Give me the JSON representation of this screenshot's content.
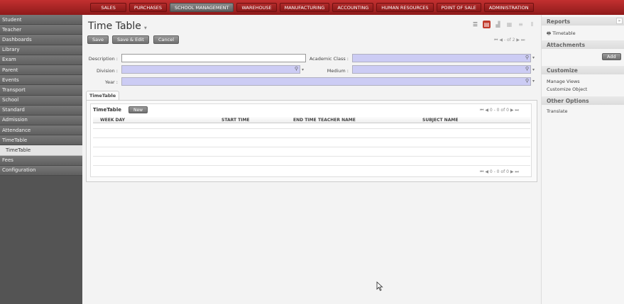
{
  "top_menu": [
    "SALES",
    "PURCHASES",
    "SCHOOL MANAGEMENT",
    "WAREHOUSE",
    "MANUFACTURING",
    "ACCOUNTING",
    "HUMAN RESOURCES",
    "POINT OF SALE",
    "ADMINISTRATION"
  ],
  "top_menu_active": "SCHOOL MANAGEMENT",
  "sidebar": {
    "items": [
      "Student",
      "Teacher",
      "Dashboards",
      "Library",
      "Exam",
      "Parent",
      "Events",
      "Transport",
      "School",
      "Standard",
      "Admission",
      "Attendance",
      "TimeTable",
      "TimeTable",
      "Fees",
      "Configuration"
    ]
  },
  "page": {
    "title": "Time Table",
    "buttons": {
      "save": "Save",
      "save_edit": "Save & Edit",
      "cancel": "Cancel"
    },
    "pager": "- of 2",
    "view_icons": [
      "list-view-icon",
      "form-view-icon",
      "graph-view-icon",
      "calendar-view-icon",
      "gantt-view-icon",
      "kanban-view-icon"
    ]
  },
  "form": {
    "description_label": "Description :",
    "description_value": "",
    "academic_class_label": "Academic Class :",
    "division_label": "Division :",
    "medium_label": "Medium :",
    "year_label": "Year :"
  },
  "notebook": {
    "tab": "TimeTable",
    "o2m_title": "TimeTable",
    "new_label": "New",
    "pager_top": "0 - 0 of 0",
    "pager_bottom": "0 - 0 of 0",
    "columns": [
      "WEEK DAY",
      "START TIME",
      "END TIME",
      "TEACHER NAME",
      "SUBJECT NAME"
    ]
  },
  "right_panel": {
    "reports_header": "Reports",
    "reports_link": "Timetable",
    "attachments_header": "Attachments",
    "add_label": "Add",
    "customize_header": "Customize",
    "customize_links": [
      "Manage Views",
      "Customize Object"
    ],
    "other_header": "Other Options",
    "other_links": [
      "Translate"
    ]
  },
  "colors": {
    "topbar": "#a92222",
    "active_menu": "#6e6e6e",
    "required_field": "#ccccf4",
    "form_view_active": "#c0392b"
  }
}
